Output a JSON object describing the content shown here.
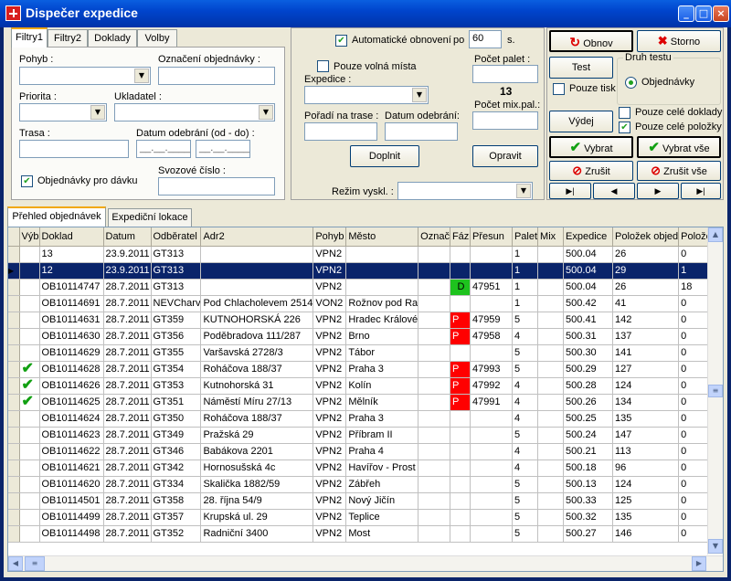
{
  "window": {
    "title": "Dispečer expedice"
  },
  "filter_tabs": [
    "Filtry1",
    "Filtry2",
    "Doklady",
    "Volby"
  ],
  "filters": {
    "pohyb_label": "Pohyb :",
    "oznaceni_label": "Označení objednávky :",
    "priorita_label": "Priorita :",
    "ukladatel_label": "Ukladatel :",
    "trasa_label": "Trasa :",
    "datum_label": "Datum odebrání (od - do) :",
    "datum_from": "__.__.____",
    "datum_to": "__.__.____",
    "davka_label": "Objednávky pro dávku",
    "svozove_label": "Svozové číslo :"
  },
  "middle": {
    "auto_refresh_label": "Automatické obnovení",
    "po_label": "po",
    "interval": "60",
    "seconds_label": "s.",
    "volna_mista_label": "Pouze volná místa",
    "expedice_label": "Expedice :",
    "poradi_label": "Pořadí na trase :",
    "datum_odebrani_label": "Datum odebrání:",
    "doplnit": "Doplnit",
    "rezim_label": "Režim vyskl. :",
    "pocet_palet_label": "Počet palet :",
    "pocet_palet_value": "13",
    "pocet_mix_label": "Počet mix.pal.:",
    "opravit": "Opravit"
  },
  "right": {
    "obnov": "Obnov",
    "storno": "Storno",
    "test": "Test",
    "pouze_tisk": "Pouze tisk",
    "druh_testu": "Druh testu",
    "objednavky": "Objednávky",
    "vydej": "Výdej",
    "pouze_cele_doklady": "Pouze celé doklady",
    "pouze_cele_polozky": "Pouze celé položky",
    "vybrat": "Vybrat",
    "vybrat_vse": "Vybrat vše",
    "zrusit": "Zrušit",
    "zrusit_vse": "Zrušit vše"
  },
  "list_tabs": [
    "Přehled objednávek",
    "Expediční lokace"
  ],
  "table": {
    "columns": [
      "Výb",
      "Doklad",
      "Datum",
      "Odběratel",
      "Adr2",
      "Pohyb",
      "Město",
      "Označ",
      "Fáz",
      "Přesun",
      "Palet",
      "Mix",
      "Expedice",
      "Položek objed",
      "Položek"
    ],
    "rows": [
      {
        "vyb": "",
        "doklad": "13",
        "datum": "23.9.2011",
        "odb": "GT313",
        "adr2": "",
        "pohyb": "VPN2",
        "mesto": "",
        "ozn": "",
        "faz": "",
        "presun": "",
        "palet": "1",
        "mix": "",
        "exp": "500.04",
        "pol_obj": "26",
        "pol": "0"
      },
      {
        "vyb": "",
        "doklad": "12",
        "datum": "23.9.2011",
        "odb": "GT313",
        "adr2": "",
        "pohyb": "VPN2",
        "mesto": "",
        "ozn": "",
        "faz": "",
        "presun": "",
        "palet": "1",
        "mix": "",
        "exp": "500.04",
        "pol_obj": "29",
        "pol": "1"
      },
      {
        "vyb": "",
        "doklad": "OB10114747",
        "datum": "28.7.2011",
        "odb": "GT313",
        "adr2": "",
        "pohyb": "VPN2",
        "mesto": "",
        "ozn": "",
        "faz": "D",
        "presun": "47951",
        "palet": "1",
        "mix": "",
        "exp": "500.04",
        "pol_obj": "26",
        "pol": "18"
      },
      {
        "vyb": "",
        "doklad": "OB10114691",
        "datum": "28.7.2011",
        "odb": "NEVCharv",
        "adr2": "Pod Chlachole​vem 2514",
        "pohyb": "VON2",
        "mesto": "Rožnov pod Ra",
        "ozn": "",
        "faz": "",
        "presun": "",
        "palet": "1",
        "mix": "",
        "exp": "500.42",
        "pol_obj": "41",
        "pol": "0"
      },
      {
        "vyb": "",
        "doklad": "OB10114631",
        "datum": "28.7.2011",
        "odb": "GT359",
        "adr2": "KUTNOHORSKÁ 226",
        "pohyb": "VPN2",
        "mesto": "Hradec Králové",
        "ozn": "",
        "faz": "P",
        "presun": "47959",
        "palet": "5",
        "mix": "",
        "exp": "500.41",
        "pol_obj": "142",
        "pol": "0"
      },
      {
        "vyb": "",
        "doklad": "OB10114630",
        "datum": "28.7.2011",
        "odb": "GT356",
        "adr2": "Poděbradova 111/287",
        "pohyb": "VPN2",
        "mesto": "Brno",
        "ozn": "",
        "faz": "P",
        "presun": "47958",
        "palet": "4",
        "mix": "",
        "exp": "500.31",
        "pol_obj": "137",
        "pol": "0"
      },
      {
        "vyb": "",
        "doklad": "OB10114629",
        "datum": "28.7.2011",
        "odb": "GT355",
        "adr2": "Varšavská 2728/3",
        "pohyb": "VPN2",
        "mesto": "Tábor",
        "ozn": "",
        "faz": "",
        "presun": "",
        "palet": "5",
        "mix": "",
        "exp": "500.30",
        "pol_obj": "141",
        "pol": "0"
      },
      {
        "vyb": "✔",
        "doklad": "OB10114628",
        "datum": "28.7.2011",
        "odb": "GT354",
        "adr2": "Roháčova 188/37",
        "pohyb": "VPN2",
        "mesto": "Praha 3",
        "ozn": "",
        "faz": "P",
        "presun": "47993",
        "palet": "5",
        "mix": "",
        "exp": "500.29",
        "pol_obj": "127",
        "pol": "0"
      },
      {
        "vyb": "✔",
        "doklad": "OB10114626",
        "datum": "28.7.2011",
        "odb": "GT353",
        "adr2": "Kutnohorská 31",
        "pohyb": "VPN2",
        "mesto": "Kolín",
        "ozn": "",
        "faz": "P",
        "presun": "47992",
        "palet": "4",
        "mix": "",
        "exp": "500.28",
        "pol_obj": "124",
        "pol": "0"
      },
      {
        "vyb": "✔",
        "doklad": "OB10114625",
        "datum": "28.7.2011",
        "odb": "GT351",
        "adr2": "Náměstí Míru 27/13",
        "pohyb": "VPN2",
        "mesto": "Mělník",
        "ozn": "",
        "faz": "P",
        "presun": "47991",
        "palet": "4",
        "mix": "",
        "exp": "500.26",
        "pol_obj": "134",
        "pol": "0"
      },
      {
        "vyb": "",
        "doklad": "OB10114624",
        "datum": "28.7.2011",
        "odb": "GT350",
        "adr2": "Roháčova 188/37",
        "pohyb": "VPN2",
        "mesto": "Praha 3",
        "ozn": "",
        "faz": "",
        "presun": "",
        "palet": "4",
        "mix": "",
        "exp": "500.25",
        "pol_obj": "135",
        "pol": "0"
      },
      {
        "vyb": "",
        "doklad": "OB10114623",
        "datum": "28.7.2011",
        "odb": "GT349",
        "adr2": "Pražská 29",
        "pohyb": "VPN2",
        "mesto": "Příbram II",
        "ozn": "",
        "faz": "",
        "presun": "",
        "palet": "5",
        "mix": "",
        "exp": "500.24",
        "pol_obj": "147",
        "pol": "0"
      },
      {
        "vyb": "",
        "doklad": "OB10114622",
        "datum": "28.7.2011",
        "odb": "GT346",
        "adr2": "Babákova 2201",
        "pohyb": "VPN2",
        "mesto": "Praha 4",
        "ozn": "",
        "faz": "",
        "presun": "",
        "palet": "4",
        "mix": "",
        "exp": "500.21",
        "pol_obj": "113",
        "pol": "0"
      },
      {
        "vyb": "",
        "doklad": "OB10114621",
        "datum": "28.7.2011",
        "odb": "GT342",
        "adr2": "Hornosušská 4c",
        "pohyb": "VPN2",
        "mesto": "Havířov - Prost",
        "ozn": "",
        "faz": "",
        "presun": "",
        "palet": "4",
        "mix": "",
        "exp": "500.18",
        "pol_obj": "96",
        "pol": "0"
      },
      {
        "vyb": "",
        "doklad": "OB10114620",
        "datum": "28.7.2011",
        "odb": "GT334",
        "adr2": "Skalička 1882/59",
        "pohyb": "VPN2",
        "mesto": "Zábřeh",
        "ozn": "",
        "faz": "",
        "presun": "",
        "palet": "5",
        "mix": "",
        "exp": "500.13",
        "pol_obj": "124",
        "pol": "0"
      },
      {
        "vyb": "",
        "doklad": "OB10114501",
        "datum": "28.7.2011",
        "odb": "GT358",
        "adr2": "28. října 54/9",
        "pohyb": "VPN2",
        "mesto": "Nový Jičín",
        "ozn": "",
        "faz": "",
        "presun": "",
        "palet": "5",
        "mix": "",
        "exp": "500.33",
        "pol_obj": "125",
        "pol": "0"
      },
      {
        "vyb": "",
        "doklad": "OB10114499",
        "datum": "28.7.2011",
        "odb": "GT357",
        "adr2": "Krupská ul. 29",
        "pohyb": "VPN2",
        "mesto": "Teplice",
        "ozn": "",
        "faz": "",
        "presun": "",
        "palet": "5",
        "mix": "",
        "exp": "500.32",
        "pol_obj": "135",
        "pol": "0"
      },
      {
        "vyb": "",
        "doklad": "OB10114498",
        "datum": "28.7.2011",
        "odb": "GT352",
        "adr2": "Radniční 3400",
        "pohyb": "VPN2",
        "mesto": "Most",
        "ozn": "",
        "faz": "",
        "presun": "",
        "palet": "5",
        "mix": "",
        "exp": "500.27",
        "pol_obj": "146",
        "pol": "0"
      }
    ]
  },
  "colors": {
    "title_bar": "#0044cc",
    "selected_row": "#0a246a",
    "phase_d": "#1ec31e",
    "phase_p": "#ff0000"
  }
}
